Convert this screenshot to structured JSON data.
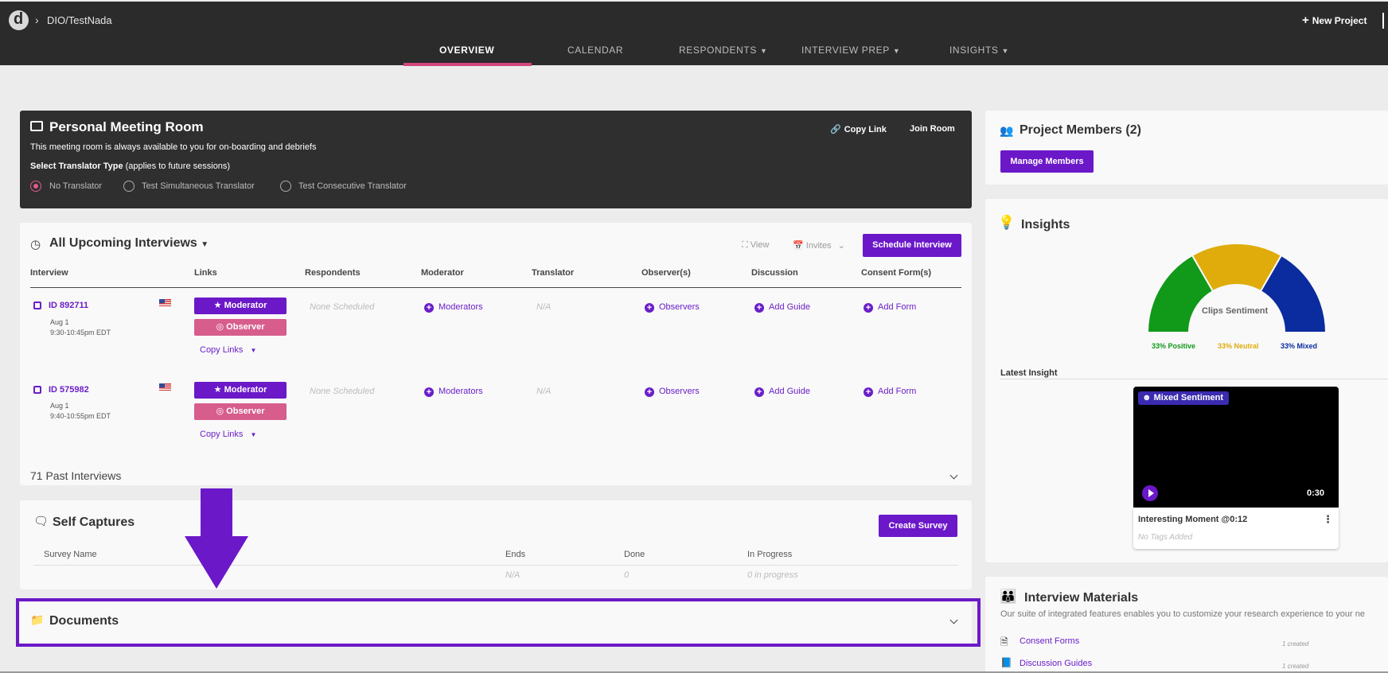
{
  "topbar": {
    "breadcrumb": "DIO/TestNada",
    "new_project": "New Project",
    "nav": [
      "OVERVIEW",
      "CALENDAR",
      "RESPONDENTS",
      "INTERVIEW PREP",
      "INSIGHTS"
    ]
  },
  "meeting_room": {
    "title": "Personal Meeting Room",
    "description": "This meeting room is always available to you for on-boarding and debriefs",
    "translator_label": "Select Translator Type",
    "translator_note": " (applies to future sessions)",
    "options": [
      "No Translator",
      "Test Simultaneous Translator",
      "Test Consecutive Translator"
    ],
    "selected_option": "No Translator",
    "copy_link": "Copy Link",
    "join_room": "Join Room"
  },
  "interviews": {
    "title": "All Upcoming Interviews",
    "view": "View",
    "invites": "Invites",
    "schedule": "Schedule Interview",
    "columns": [
      "Interview",
      "Links",
      "Respondents",
      "Moderator",
      "Translator",
      "Observer(s)",
      "Discussion",
      "Consent Form(s)"
    ],
    "rows": [
      {
        "id": "ID 892711",
        "date": "Aug 1",
        "time": "9:30-10:45pm EDT",
        "moderator_btn": "Moderator",
        "observer_btn": "Observer",
        "copy_links": "Copy Links",
        "respondents": "None Scheduled",
        "moderators": "Moderators",
        "translator": "N/A",
        "observers": "Observers",
        "guide": "Add Guide",
        "form": "Add Form"
      },
      {
        "id": "ID 575982",
        "date": "Aug 1",
        "time": "9:40-10:55pm EDT",
        "moderator_btn": "Moderator",
        "observer_btn": "Observer",
        "copy_links": "Copy Links",
        "respondents": "None Scheduled",
        "moderators": "Moderators",
        "translator": "N/A",
        "observers": "Observers",
        "guide": "Add Guide",
        "form": "Add Form"
      }
    ],
    "past": "71 Past Interviews"
  },
  "self_captures": {
    "title": "Self Captures",
    "create": "Create Survey",
    "columns": [
      "Survey Name",
      "Ends",
      "Done",
      "In Progress"
    ],
    "row": {
      "ends": "N/A",
      "done": "0",
      "in_progress": "0 in progress"
    }
  },
  "documents": {
    "title": "Documents"
  },
  "members": {
    "title": "Project Members (2)",
    "manage": "Manage Members"
  },
  "insights": {
    "title": "Insights",
    "gauge_label": "Clips Sentiment",
    "segments": [
      {
        "label": "33% Positive",
        "color": "#11991a",
        "share": 0.33
      },
      {
        "label": "33% Neutral",
        "color": "#e0ac0b",
        "share": 0.33
      },
      {
        "label": "33% Mixed",
        "color": "#0a2c9e",
        "share": 0.33
      }
    ],
    "latest": "Latest Insight",
    "badge": "Mixed Sentiment",
    "duration": "0:30",
    "clip_title": "Interesting Moment @0:12",
    "tags": "No Tags Added"
  },
  "materials": {
    "title": "Interview Materials",
    "description": "Our suite of integrated features enables you to customize your research experience to your ne",
    "items": [
      {
        "label": "Consent Forms",
        "count": "1 created"
      },
      {
        "label": "Discussion Guides",
        "count": "1 created"
      }
    ]
  }
}
